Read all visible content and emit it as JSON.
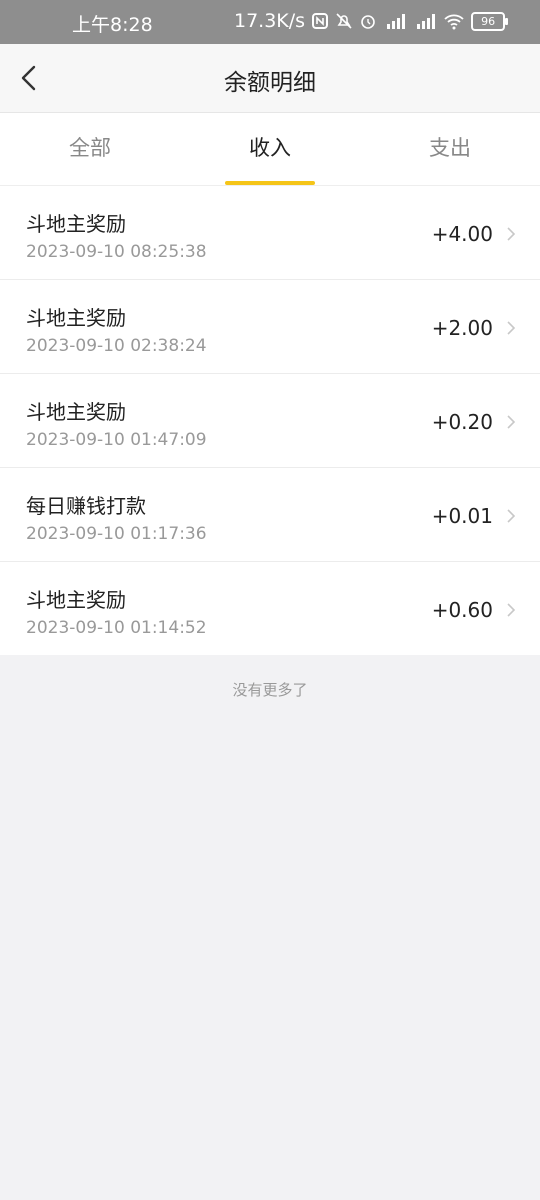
{
  "status": {
    "time": "上午8:28",
    "speed": "17.3K/s",
    "battery": "96"
  },
  "nav": {
    "title": "余额明细"
  },
  "tabs": [
    {
      "label": "全部"
    },
    {
      "label": "收入"
    },
    {
      "label": "支出"
    }
  ],
  "active_tab": "收入",
  "records": [
    {
      "title": "斗地主奖励",
      "date": "2023-09-10 08:25:38",
      "amount": "+4.00"
    },
    {
      "title": "斗地主奖励",
      "date": "2023-09-10 02:38:24",
      "amount": "+2.00"
    },
    {
      "title": "斗地主奖励",
      "date": "2023-09-10 01:47:09",
      "amount": "+0.20"
    },
    {
      "title": "每日赚钱打款",
      "date": "2023-09-10 01:17:36",
      "amount": "+0.01"
    },
    {
      "title": "斗地主奖励",
      "date": "2023-09-10 01:14:52",
      "amount": "+0.60"
    }
  ],
  "footer": {
    "no_more": "没有更多了"
  },
  "colors": {
    "accent": "#f5c518",
    "status_bar": "#8e8e8e",
    "background": "#f2f2f4"
  }
}
